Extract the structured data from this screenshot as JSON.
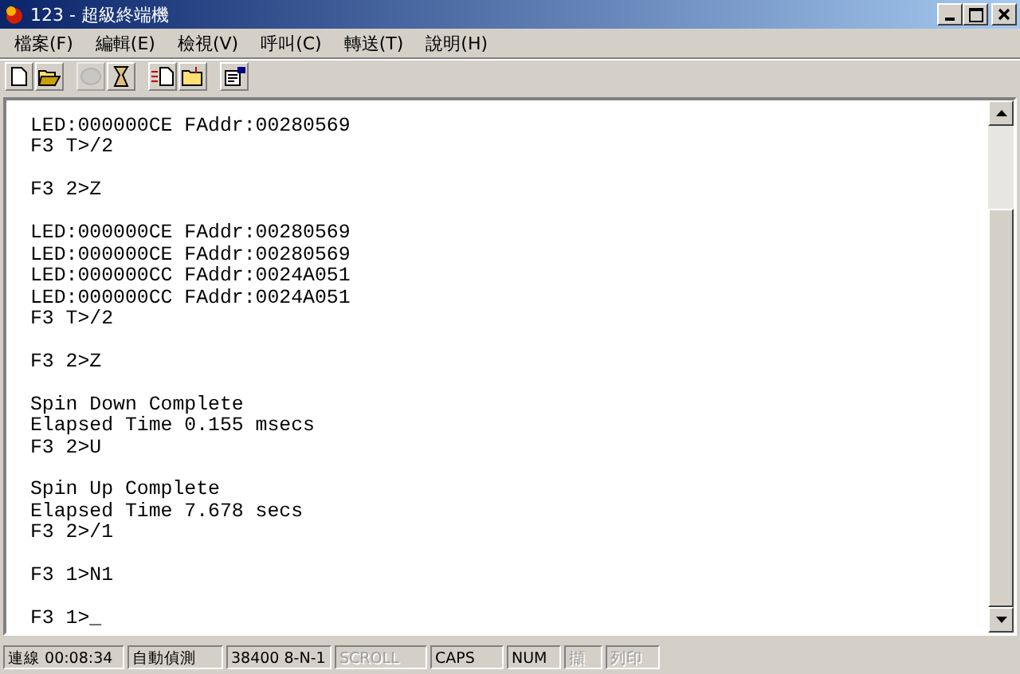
{
  "window": {
    "title": "123 - 超級終端機"
  },
  "menu": [
    {
      "label": "檔案(F)"
    },
    {
      "label": "編輯(E)"
    },
    {
      "label": "檢視(V)"
    },
    {
      "label": "呼叫(C)"
    },
    {
      "label": "轉送(T)"
    },
    {
      "label": "說明(H)"
    }
  ],
  "toolbar": [
    {
      "kind": "new",
      "disabled": false
    },
    {
      "kind": "open",
      "disabled": false
    },
    {
      "kind": "sep"
    },
    {
      "kind": "call",
      "disabled": true
    },
    {
      "kind": "hangup",
      "disabled": false
    },
    {
      "kind": "sep"
    },
    {
      "kind": "send",
      "disabled": false
    },
    {
      "kind": "receive",
      "disabled": false
    },
    {
      "kind": "sep"
    },
    {
      "kind": "properties",
      "disabled": false
    }
  ],
  "terminal": {
    "blocks": [
      [
        "LED:000000CE FAddr:00280569",
        "F3 T>/2"
      ],
      [
        "F3 2>Z"
      ],
      [
        "LED:000000CE FAddr:00280569",
        "LED:000000CE FAddr:00280569",
        "LED:000000CC FAddr:0024A051",
        "LED:000000CC FAddr:0024A051",
        "F3 T>/2"
      ],
      [
        "F3 2>Z"
      ],
      [
        "Spin Down Complete",
        "Elapsed Time 0.155 msecs",
        "F3 2>U"
      ],
      [
        "Spin Up Complete",
        "Elapsed Time 7.678 secs",
        "F3 2>/1"
      ],
      [
        "F3 1>N1"
      ],
      [
        "F3 1>_"
      ]
    ]
  },
  "status_bar": [
    {
      "text": "連線 00:08:34",
      "disabled": false
    },
    {
      "text": "自動偵測",
      "disabled": false
    },
    {
      "text": "38400 8-N-1",
      "disabled": false
    },
    {
      "text": "SCROLL",
      "disabled": true
    },
    {
      "text": "CAPS",
      "disabled": false
    },
    {
      "text": "NUM",
      "disabled": false
    },
    {
      "text": "擷",
      "disabled": true
    },
    {
      "text": "列印",
      "disabled": true
    }
  ]
}
